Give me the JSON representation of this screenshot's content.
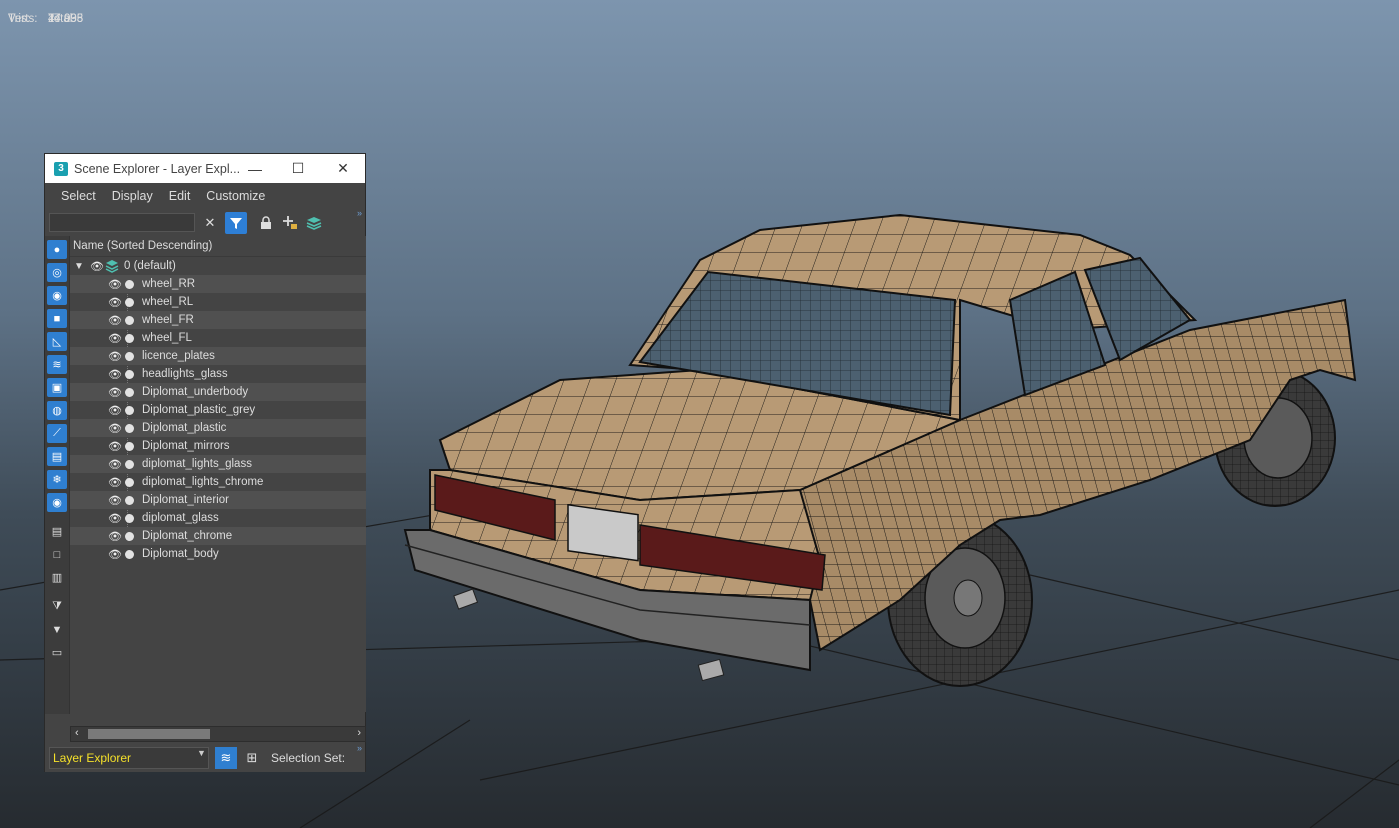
{
  "stats": {
    "header": "Total",
    "rows": [
      {
        "label": "Tris:",
        "value": "44 938"
      },
      {
        "label": "Verts:",
        "value": "27 095"
      }
    ]
  },
  "window": {
    "title": "Scene Explorer - Layer Expl...",
    "app_icon": "3",
    "controls": {
      "minimize": "—",
      "maximize": "☐",
      "close": "✕"
    }
  },
  "menu": [
    "Select",
    "Display",
    "Edit",
    "Customize"
  ],
  "toolbar": {
    "search_placeholder": "",
    "icons": [
      "clear-icon",
      "filter-icon",
      "lock-icon",
      "add-layer-icon",
      "layers-icon"
    ]
  },
  "sidebar_icons": [
    "geometry-icon",
    "shapes-icon",
    "lights-icon",
    "cameras-icon",
    "helpers-icon",
    "spacewarps-icon",
    "groups-icon",
    "xrefs-icon",
    "bones-icon",
    "containers-icon",
    "frozen-icon",
    "hidden-icon",
    "all-icon",
    "none-icon",
    "invert-icon",
    "filter-clear-icon",
    "filter-icon",
    "selection-set-icon"
  ],
  "tree": {
    "header": "Name (Sorted Descending)",
    "root": "0 (default)",
    "layers": [
      "wheel_RR",
      "wheel_RL",
      "wheel_FR",
      "wheel_FL",
      "licence_plates",
      "headlights_glass",
      "Diplomat_underbody",
      "Diplomat_plastic_grey",
      "Diplomat_plastic",
      "Diplomat_mirrors",
      "diplomat_lights_glass",
      "diplomat_lights_chrome",
      "Diplomat_interior",
      "diplomat_glass",
      "Diplomat_chrome",
      "Diplomat_body"
    ]
  },
  "bottom": {
    "explorer_select": "Layer Explorer",
    "selection_sets": "Selection Set:"
  },
  "colors": {
    "car_body": "#b89a75",
    "accent": "#2f7fd0",
    "explorer_text": "#f4e02a"
  }
}
